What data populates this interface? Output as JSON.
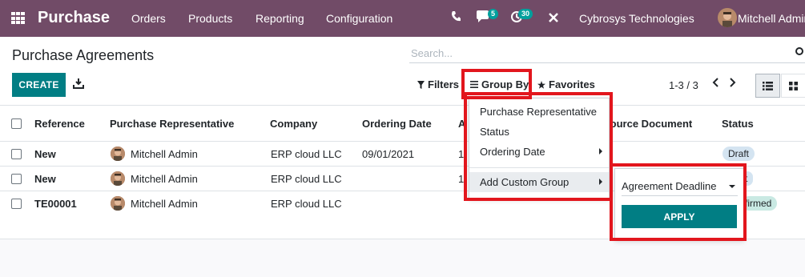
{
  "navbar": {
    "app_title": "Purchase",
    "menus": [
      "Orders",
      "Products",
      "Reporting",
      "Configuration"
    ],
    "messages_count": "5",
    "activities_count": "30",
    "company": "Cybrosys Technologies",
    "user": "Mitchell Admin"
  },
  "control_panel": {
    "title": "Purchase Agreements",
    "search_placeholder": "Search...",
    "create_label": "CREATE",
    "filters_label": "Filters",
    "groupby_label": "Group By",
    "favorites_label": "Favorites",
    "pager": "1-3 / 3"
  },
  "table": {
    "headers": [
      "Reference",
      "Purchase Representative",
      "Company",
      "Ordering Date",
      "A",
      "Source Document",
      "Status"
    ],
    "rows": [
      {
        "reference": "New",
        "rep": "Mitchell Admin",
        "company": "ERP cloud LLC",
        "ordering_date": "09/01/2021",
        "a": "1",
        "status": "Draft"
      },
      {
        "reference": "New",
        "rep": "Mitchell Admin",
        "company": "ERP cloud LLC",
        "ordering_date": "",
        "a": "1",
        "status": "t"
      },
      {
        "reference": "TE00001",
        "rep": "Mitchell Admin",
        "company": "ERP cloud LLC",
        "ordering_date": "",
        "a": "",
        "status": "firmed"
      }
    ]
  },
  "groupby_menu": {
    "items": [
      "Purchase Representative",
      "Status",
      "Ordering Date"
    ],
    "custom_group_label": "Add Custom Group",
    "custom_field": "Agreement Deadline",
    "apply_label": "APPLY"
  },
  "colors": {
    "navbar": "#714b67",
    "primary_button": "#017e84",
    "badge": "#00a09d",
    "highlight": "#e2161d",
    "draft_badge": "#d4e4f1",
    "confirmed_badge": "#c9e9e3"
  }
}
